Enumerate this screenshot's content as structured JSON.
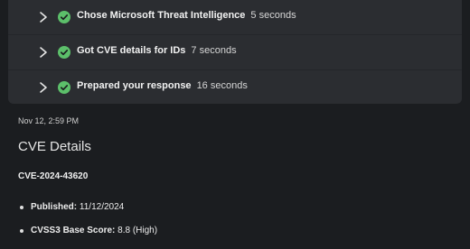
{
  "steps": [
    {
      "title": "Chose Microsoft Threat Intelligence",
      "duration": "5 seconds"
    },
    {
      "title": "Got CVE details for IDs",
      "duration": "7 seconds"
    },
    {
      "title": "Prepared your response",
      "duration": "16 seconds"
    }
  ],
  "message": {
    "timestamp": "Nov 12, 2:59 PM",
    "heading": "CVE Details",
    "cve_id": "CVE-2024-43620",
    "details": [
      {
        "label": "Published:",
        "value": "11/12/2024"
      },
      {
        "label": "CVSS3 Base Score:",
        "value": "8.8 (High)"
      }
    ]
  },
  "colors": {
    "success": "#5cbf6a",
    "panel": "#2b2d31",
    "background": "#1b1d20"
  },
  "icons": {
    "step_expand": "chevron-right-icon",
    "step_status": "check-circle-icon"
  }
}
